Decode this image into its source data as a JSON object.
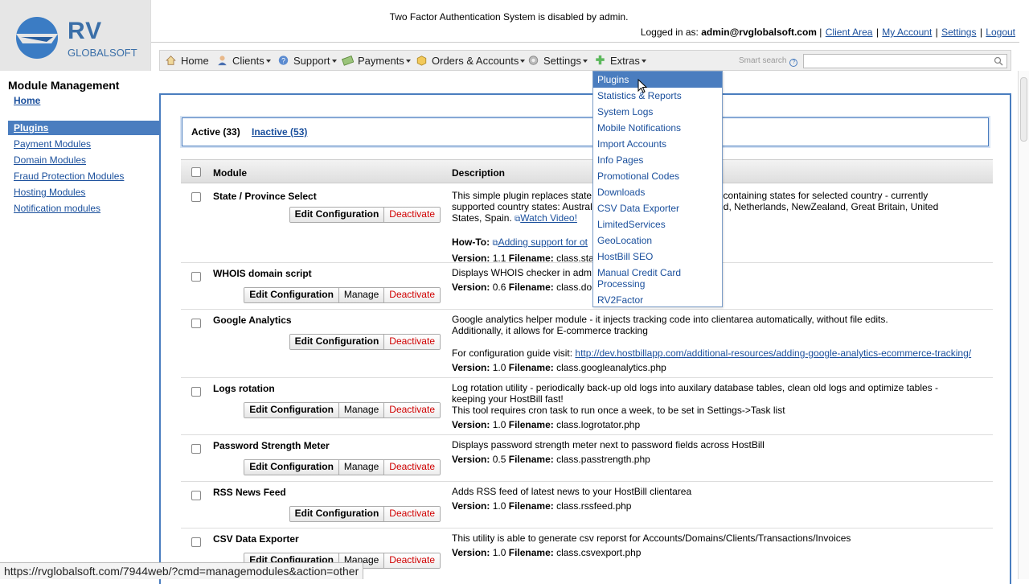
{
  "brand": {
    "logo_main": "RV",
    "logo_sub": "GLOBALSOFT",
    "accent": "#4a7dbf"
  },
  "header": {
    "notice": "Two Factor Authentication System is disabled by admin.",
    "logged_in_label": "Logged in as:",
    "user": "admin@rvglobalsoft.com",
    "links": [
      "Client Area",
      "My Account",
      "Settings",
      "Logout"
    ],
    "separator": "|"
  },
  "nav": {
    "items": [
      {
        "label": "Home",
        "icon": "home-icon"
      },
      {
        "label": "Clients",
        "icon": "user-icon"
      },
      {
        "label": "Support",
        "icon": "help-icon"
      },
      {
        "label": "Payments",
        "icon": "money-icon"
      },
      {
        "label": "Orders & Accounts",
        "icon": "box-icon"
      },
      {
        "label": "Settings",
        "icon": "gear-icon"
      },
      {
        "label": "Extras",
        "icon": "puzzle-icon"
      }
    ],
    "smart_search_label": "Smart search",
    "smart_search_help": "?"
  },
  "sidebar": {
    "title": "Module Management",
    "home": "Home",
    "items": [
      "Plugins",
      "Payment Modules",
      "Domain Modules",
      "Fraud Protection Modules",
      "Hosting Modules",
      "Notification modules"
    ]
  },
  "tabs": {
    "active": "Active (33)",
    "inactive": "Inactive (53)"
  },
  "table": {
    "headers": {
      "module": "Module",
      "description": "Description"
    },
    "buttons": {
      "edit": "Edit Configuration",
      "manage": "Manage",
      "deactivate": "Deactivate"
    },
    "rows": [
      {
        "name": "State / Province Select",
        "desc1": "This simple plugin replaces state",
        "desc1b": "ct box containing states for selected country - currently",
        "desc2": "supported country states: Austral",
        "desc2b": "Ireland, Netherlands, NewZealand, Great Britain, United",
        "desc3": "States, Spain.",
        "video": "Watch Video!",
        "howto_label": "How-To:",
        "howto_link": "Adding support for ot",
        "version_label": "Version:",
        "version": "1.1",
        "filename_label": "Filename:",
        "filename": "class.state_"
      },
      {
        "name": "WHOIS domain script",
        "desc1": "Displays WHOIS checker in adm",
        "version": "0.6",
        "filename": "class.domai"
      },
      {
        "name": "Google Analytics",
        "desc1": "Google analytics helper module - it injects tracking code into clientarea automatically, without file edits.",
        "desc2": "Additionally, it allows for E-commerce tracking",
        "desc3": "For configuration guide visit:",
        "link": "http://dev.hostbillapp.com/additional-resources/adding-google-analytics-ecommerce-tracking/",
        "version": "1.0",
        "filename": "class.googleanalytics.php"
      },
      {
        "name": "Logs rotation",
        "desc1": "Log rotation utility - periodically back-up old logs into auxilary database tables, clean old logs and optimize tables -",
        "desc2": "keeping your HostBill fast!",
        "desc3": "This tool requires cron task to run once a week, to be set in Settings->Task list",
        "version": "1.0",
        "filename": "class.logrotator.php"
      },
      {
        "name": "Password Strength Meter",
        "desc1": "Displays password strength meter next to password fields across HostBill",
        "version": "0.5",
        "filename": "class.passtrength.php"
      },
      {
        "name": "RSS News Feed",
        "desc1": "Adds RSS feed of latest news to your HostBill clientarea",
        "version": "1.0",
        "filename": "class.rssfeed.php"
      },
      {
        "name": "CSV Data Exporter",
        "desc1": "This utility is able to generate csv reporst for Accounts/Domains/Clients/Transactions/Invoices",
        "version": "1.0",
        "filename": "class.csvexport.php"
      }
    ]
  },
  "extras_menu": {
    "items": [
      "Plugins",
      "Statistics & Reports",
      "System Logs",
      "Mobile Notifications",
      "Import Accounts",
      "Info Pages",
      "Promotional Codes",
      "Downloads",
      "CSV Data Exporter",
      "LimitedServices",
      "GeoLocation",
      "HostBill SEO",
      "Manual Credit Card Processing",
      "RV2Factor"
    ]
  },
  "status_bar": {
    "url": "https://rvglobalsoft.com/7944web/?cmd=managemodules&action=other"
  }
}
